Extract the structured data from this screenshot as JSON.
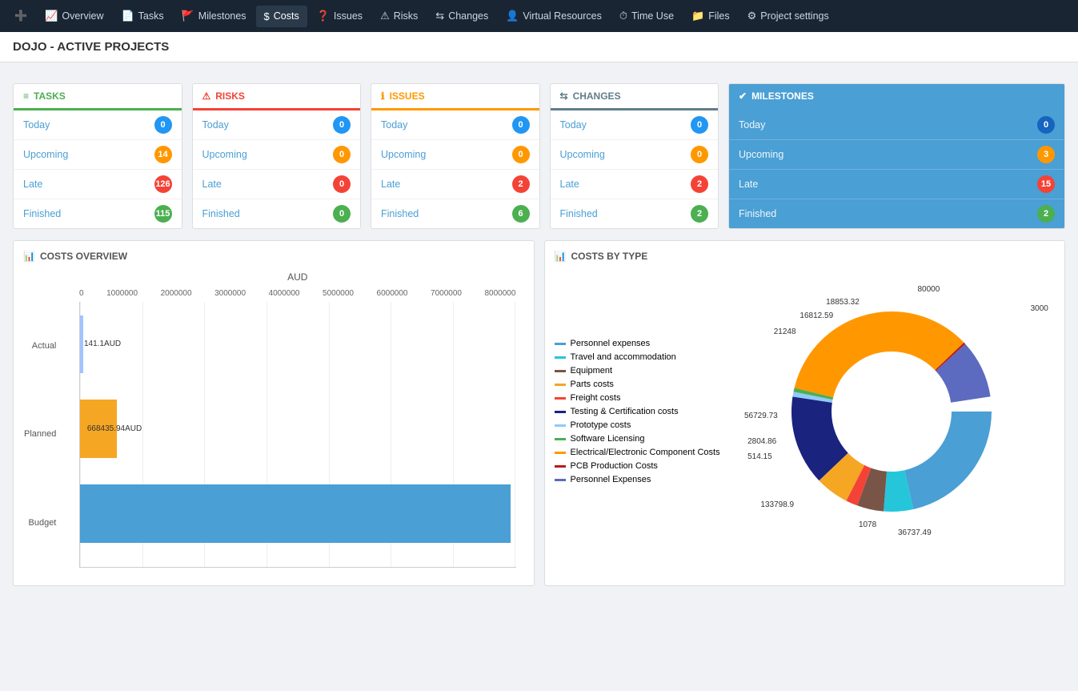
{
  "nav": {
    "items": [
      {
        "label": "Overview",
        "icon": "📈",
        "name": "overview"
      },
      {
        "label": "Tasks",
        "icon": "📄",
        "name": "tasks"
      },
      {
        "label": "Milestones",
        "icon": "🚩",
        "name": "milestones"
      },
      {
        "label": "Costs",
        "icon": "$",
        "name": "costs",
        "active": true
      },
      {
        "label": "Issues",
        "icon": "?",
        "name": "issues"
      },
      {
        "label": "Risks",
        "icon": "⚠",
        "name": "risks"
      },
      {
        "label": "Changes",
        "icon": "⇆",
        "name": "changes"
      },
      {
        "label": "Virtual Resources",
        "icon": "👤",
        "name": "virtual-resources"
      },
      {
        "label": "Time Use",
        "icon": "⏱",
        "name": "time-use"
      },
      {
        "label": "Files",
        "icon": "📁",
        "name": "files"
      },
      {
        "label": "Project settings",
        "icon": "⚙",
        "name": "project-settings"
      }
    ]
  },
  "page_title": "DOJO - ACTIVE PROJECTS",
  "tasks_card": {
    "header": "TASKS",
    "rows": [
      {
        "label": "Today",
        "badge": "0",
        "badge_type": "blue"
      },
      {
        "label": "Upcoming",
        "badge": "14",
        "badge_type": "yellow"
      },
      {
        "label": "Late",
        "badge": "126",
        "badge_type": "red"
      },
      {
        "label": "Finished",
        "badge": "115",
        "badge_type": "green"
      }
    ]
  },
  "risks_card": {
    "header": "RISKS",
    "rows": [
      {
        "label": "Today",
        "badge": "0",
        "badge_type": "blue"
      },
      {
        "label": "Upcoming",
        "badge": "0",
        "badge_type": "yellow"
      },
      {
        "label": "Late",
        "badge": "0",
        "badge_type": "red"
      },
      {
        "label": "Finished",
        "badge": "0",
        "badge_type": "green"
      }
    ]
  },
  "issues_card": {
    "header": "ISSUES",
    "rows": [
      {
        "label": "Today",
        "badge": "0",
        "badge_type": "blue"
      },
      {
        "label": "Upcoming",
        "badge": "0",
        "badge_type": "yellow"
      },
      {
        "label": "Late",
        "badge": "2",
        "badge_type": "red"
      },
      {
        "label": "Finished",
        "badge": "6",
        "badge_type": "green"
      }
    ]
  },
  "changes_card": {
    "header": "CHANGES",
    "rows": [
      {
        "label": "Today",
        "badge": "0",
        "badge_type": "blue"
      },
      {
        "label": "Upcoming",
        "badge": "0",
        "badge_type": "yellow"
      },
      {
        "label": "Late",
        "badge": "2",
        "badge_type": "red"
      },
      {
        "label": "Finished",
        "badge": "2",
        "badge_type": "green"
      }
    ]
  },
  "milestones_card": {
    "header": "MILESTONES",
    "rows": [
      {
        "label": "Today",
        "badge": "0",
        "badge_type": "blue"
      },
      {
        "label": "Upcoming",
        "badge": "3",
        "badge_type": "yellow"
      },
      {
        "label": "Late",
        "badge": "15",
        "badge_type": "red"
      },
      {
        "label": "Finished",
        "badge": "2",
        "badge_type": "green"
      }
    ]
  },
  "costs_overview": {
    "title": "COSTS OVERVIEW",
    "currency": "AUD",
    "bars": [
      {
        "label": "Actual",
        "value": 141.1,
        "max": 8000000,
        "color": "actual",
        "text": "141.1AUD"
      },
      {
        "label": "Planned",
        "value": 668435.94,
        "max": 8000000,
        "color": "planned",
        "text": "668435.94AUD"
      },
      {
        "label": "Budget",
        "value": 7900000,
        "max": 8000000,
        "color": "budget",
        "text": ""
      }
    ],
    "x_labels": [
      "0",
      "1000000",
      "2000000",
      "3000000",
      "4000000",
      "5000000",
      "6000000",
      "7000000",
      "8000000"
    ]
  },
  "costs_by_type": {
    "title": "COSTS BY TYPE",
    "legend": [
      {
        "label": "Personnel expenses",
        "color": "#4a9fd4"
      },
      {
        "label": "Travel and accommodation",
        "color": "#26c6da"
      },
      {
        "label": "Equipment",
        "color": "#795548"
      },
      {
        "label": "Parts costs",
        "color": "#f5a623"
      },
      {
        "label": "Freight costs",
        "color": "#f44336"
      },
      {
        "label": "Testing & Certification costs",
        "color": "#1a237e"
      },
      {
        "label": "Prototype costs",
        "color": "#90caf9"
      },
      {
        "label": "Software Licensing",
        "color": "#4caf50"
      },
      {
        "label": "Electrical/Electronic Component Costs",
        "color": "#ff9800"
      },
      {
        "label": "PCB Production Costs",
        "color": "#b71c1c"
      },
      {
        "label": "Personnel Expenses",
        "color": "#5c6bc0"
      }
    ],
    "data_labels": [
      {
        "value": "80000",
        "angle": "top-right"
      },
      {
        "value": "18853.32",
        "angle": "upper-right"
      },
      {
        "value": "16812.59",
        "angle": "right"
      },
      {
        "value": "21248",
        "angle": "right-mid"
      },
      {
        "value": "56729.73",
        "angle": "mid"
      },
      {
        "value": "2804.86",
        "angle": "lower-mid"
      },
      {
        "value": "514.15",
        "angle": "lower"
      },
      {
        "value": "3000",
        "angle": "far-right"
      },
      {
        "value": "133798.9",
        "angle": "bottom-left"
      },
      {
        "value": "1078",
        "angle": "bottom"
      },
      {
        "value": "36737.49",
        "angle": "bottom-right"
      }
    ]
  }
}
